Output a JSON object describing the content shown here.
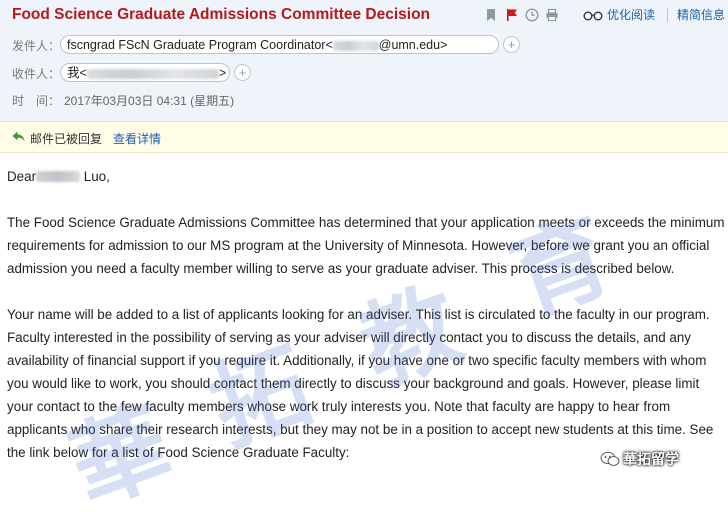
{
  "email": {
    "subject": "Food Science Graduate Admissions Committee Decision",
    "toolbar": {
      "optimize_read_label": "优化阅读",
      "lang_switch_label": "精简信息"
    },
    "sender": {
      "label": "发件人：",
      "display": "fscngrad FScN Graduate Program Coordinator<",
      "email_suffix": "@umn.edu>"
    },
    "recipient": {
      "label": "收件人：",
      "display": "我<",
      "close": ">"
    },
    "time": {
      "label": "时　间：",
      "value": "2017年03月03日 04:31 (星期五)"
    },
    "notice": {
      "replied_text": "邮件已被回复",
      "view_details": "查看详情"
    },
    "body": {
      "greeting_prefix": "Dear",
      "greeting_suffix": " Luo,",
      "paragraph1": "The Food Science Graduate Admissions Committee has determined that your application meets or exceeds the minimum requirements for admission to our MS program at the University of Minnesota.  However, before we grant you an official admission you need a faculty member willing to serve as your graduate adviser. This process is described below.",
      "paragraph2": "Your name will be added to a list of applicants looking for an adviser. This list is circulated to the faculty in our program. Faculty interested in the possibility of serving as your adviser will directly contact you to discuss the details, and any availability of financial support if you require it. Additionally, if you have one or two specific faculty members with whom you would like to work, you should contact them directly to discuss your background and goals.  However, please limit your contact to the few faculty members whose work truly interests you.  Note that faculty are happy to hear from applicants who share their research interests, but they may not be in a position to accept new students at this time. See the link below for a list of Food Science Graduate Faculty:"
    }
  },
  "watermark": {
    "chars": [
      "華",
      "拓",
      "教",
      "育"
    ],
    "badge": "華拓留学"
  },
  "colors": {
    "subject": "#b5191c",
    "link": "#1f5fa8",
    "header_bg": "#eef4fa",
    "notice_bg": "#fffce8"
  }
}
